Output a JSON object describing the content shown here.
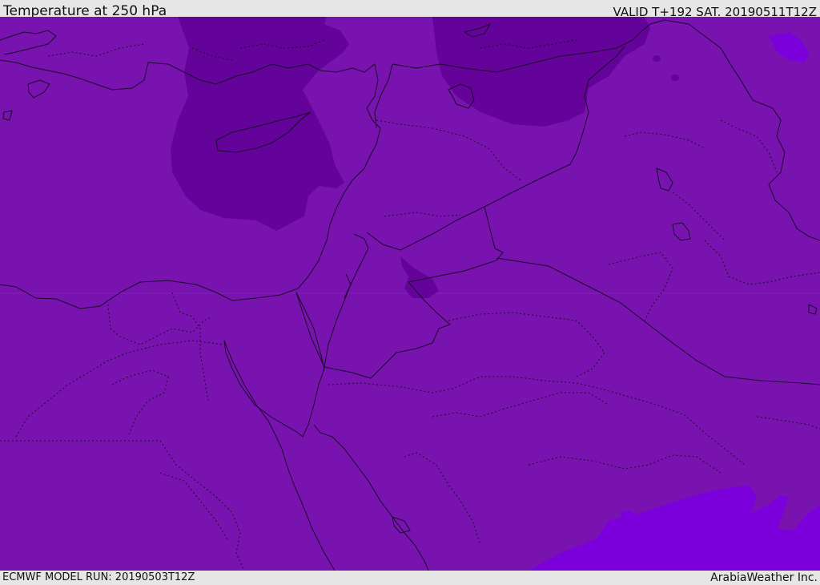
{
  "header": {
    "title": "Temperature at 250 hPa",
    "valid": "VALID T+192 SAT. 20190511T12Z"
  },
  "footer": {
    "model_run": "ECMWF MODEL RUN: 20190503T12Z",
    "credit": "ArabiaWeather Inc."
  },
  "map": {
    "field": "temperature-250hpa",
    "colors": {
      "base": "#7813b0",
      "cold": "#64039a",
      "warm": "#7b00dc",
      "coast": "#1a0a28"
    }
  }
}
